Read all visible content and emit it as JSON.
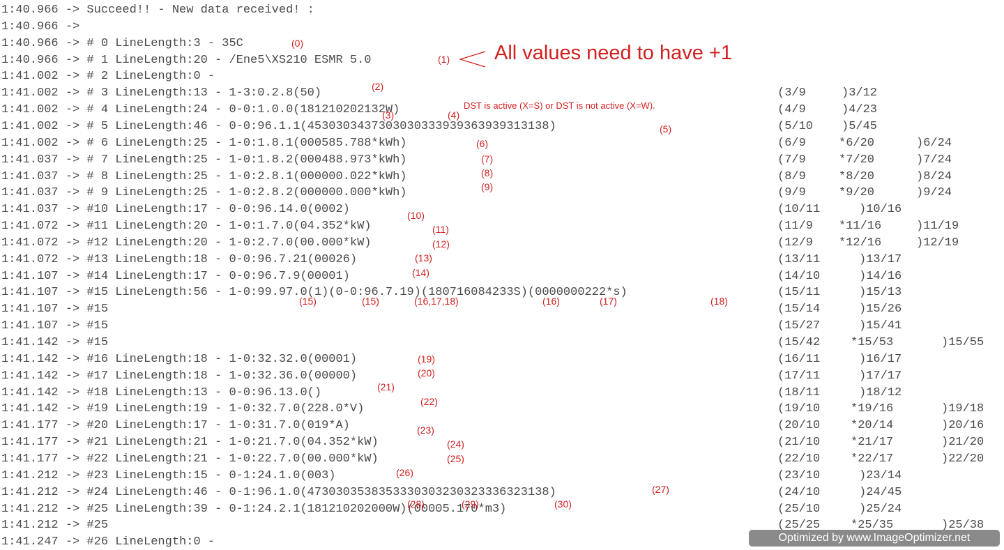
{
  "log": {
    "lines": [
      {
        "ts": "1:40.966 ->",
        "text": " Succeed!! - New data received! :"
      },
      {
        "ts": "1:40.966 ->",
        "text": ""
      },
      {
        "ts": "1:40.966 ->",
        "text": " # 0 LineLength:3 - 35C"
      },
      {
        "ts": "1:40.966 ->",
        "text": " # 1 LineLength:20 - /Ene5\\XS210 ESMR 5.0"
      },
      {
        "ts": "1:41.002 ->",
        "text": " # 2 LineLength:0 -"
      },
      {
        "ts": "1:41.002 ->",
        "text": " # 3 LineLength:13 - 1-3:0.2.8(50)"
      },
      {
        "ts": "1:41.002 ->",
        "text": " # 4 LineLength:24 - 0-0:1.0.0(181210202132W)"
      },
      {
        "ts": "1:41.002 ->",
        "text": " # 5 LineLength:46 - 0-0:96.1.1(4530303437303030333939363939313138)"
      },
      {
        "ts": "1:41.002 ->",
        "text": " # 6 LineLength:25 - 1-0:1.8.1(000585.788*kWh)"
      },
      {
        "ts": "1:41.037 ->",
        "text": " # 7 LineLength:25 - 1-0:1.8.2(000488.973*kWh)"
      },
      {
        "ts": "1:41.037 ->",
        "text": " # 8 LineLength:25 - 1-0:2.8.1(000000.022*kWh)"
      },
      {
        "ts": "1:41.037 ->",
        "text": " # 9 LineLength:25 - 1-0:2.8.2(000000.000*kWh)"
      },
      {
        "ts": "1:41.037 ->",
        "text": " #10 LineLength:17 - 0-0:96.14.0(0002)"
      },
      {
        "ts": "1:41.072 ->",
        "text": " #11 LineLength:20 - 1-0:1.7.0(04.352*kW)"
      },
      {
        "ts": "1:41.072 ->",
        "text": " #12 LineLength:20 - 1-0:2.7.0(00.000*kW)"
      },
      {
        "ts": "1:41.072 ->",
        "text": " #13 LineLength:18 - 0-0:96.7.21(00026)"
      },
      {
        "ts": "1:41.107 ->",
        "text": " #14 LineLength:17 - 0-0:96.7.9(00001)"
      },
      {
        "ts": "1:41.107 ->",
        "text": " #15 LineLength:56 - 1-0:99.97.0(1)(0-0:96.7.19)(180716084233S)(0000000222*s)"
      },
      {
        "ts": "1:41.107 ->",
        "text": " #15"
      },
      {
        "ts": "1:41.107 ->",
        "text": " #15"
      },
      {
        "ts": "1:41.142 ->",
        "text": " #15"
      },
      {
        "ts": "1:41.142 ->",
        "text": " #16 LineLength:18 - 1-0:32.32.0(00001)"
      },
      {
        "ts": "1:41.142 ->",
        "text": " #17 LineLength:18 - 1-0:32.36.0(00000)"
      },
      {
        "ts": "1:41.142 ->",
        "text": " #18 LineLength:13 - 0-0:96.13.0()"
      },
      {
        "ts": "1:41.142 ->",
        "text": " #19 LineLength:19 - 1-0:32.7.0(228.0*V)"
      },
      {
        "ts": "1:41.177 ->",
        "text": " #20 LineLength:17 - 1-0:31.7.0(019*A)"
      },
      {
        "ts": "1:41.177 ->",
        "text": " #21 LineLength:21 - 1-0:21.7.0(04.352*kW)"
      },
      {
        "ts": "1:41.177 ->",
        "text": " #22 LineLength:21 - 1-0:22.7.0(00.000*kW)"
      },
      {
        "ts": "1:41.212 ->",
        "text": " #23 LineLength:15 - 0-1:24.1.0(003)"
      },
      {
        "ts": "1:41.212 ->",
        "text": " #24 LineLength:46 - 0-1:96.1.0(4730303538353330303230323336323138)"
      },
      {
        "ts": "1:41.212 ->",
        "text": " #25 LineLength:39 - 0-1:24.2.1(181210202000W)(00005.170*m3)"
      },
      {
        "ts": "1:41.212 ->",
        "text": " #25"
      },
      {
        "ts": "1:41.247 ->",
        "text": " #26 LineLength:0 -"
      }
    ]
  },
  "right_columns": [
    {
      "row": 5,
      "c1": "(3/9",
      "c2": ")3/12",
      "c3": ""
    },
    {
      "row": 6,
      "c1": "(4/9",
      "c2": ")4/23",
      "c3": ""
    },
    {
      "row": 7,
      "c1": "(5/10",
      "c2": ")5/45",
      "c3": ""
    },
    {
      "row": 8,
      "c1": "(6/9",
      "c2": "*6/20",
      "c3": ")6/24"
    },
    {
      "row": 9,
      "c1": "(7/9",
      "c2": "*7/20",
      "c3": ")7/24"
    },
    {
      "row": 10,
      "c1": "(8/9",
      "c2": "*8/20",
      "c3": ")8/24"
    },
    {
      "row": 11,
      "c1": "(9/9",
      "c2": "*9/20",
      "c3": ")9/24"
    },
    {
      "row": 12,
      "c1": "(10/11",
      "c2": ")10/16",
      "c3": ""
    },
    {
      "row": 13,
      "c1": "(11/9",
      "c2": "*11/16",
      "c3": ")11/19"
    },
    {
      "row": 14,
      "c1": "(12/9",
      "c2": "*12/16",
      "c3": ")12/19"
    },
    {
      "row": 15,
      "c1": "(13/11",
      "c2": ")13/17",
      "c3": ""
    },
    {
      "row": 16,
      "c1": "(14/10",
      "c2": ")14/16",
      "c3": ""
    },
    {
      "row": 17,
      "c1": "(15/11",
      "c2": ")15/13",
      "c3": ""
    },
    {
      "row": 18,
      "c1": "(15/14",
      "c2": ")15/26",
      "c3": ""
    },
    {
      "row": 19,
      "c1": "(15/27",
      "c2": ")15/41",
      "c3": ""
    },
    {
      "row": 20,
      "c1": "(15/42",
      "c2": "*15/53",
      "c3": ")15/55"
    },
    {
      "row": 21,
      "c1": "(16/11",
      "c2": ")16/17",
      "c3": ""
    },
    {
      "row": 22,
      "c1": "(17/11",
      "c2": ")17/17",
      "c3": ""
    },
    {
      "row": 23,
      "c1": "(18/11",
      "c2": ")18/12",
      "c3": ""
    },
    {
      "row": 24,
      "c1": "(19/10",
      "c2": "*19/16",
      "c3": ")19/18"
    },
    {
      "row": 25,
      "c1": "(20/10",
      "c2": "*20/14",
      "c3": ")20/16"
    },
    {
      "row": 26,
      "c1": "(21/10",
      "c2": "*21/17",
      "c3": ")21/20"
    },
    {
      "row": 27,
      "c1": "(22/10",
      "c2": "*22/17",
      "c3": ")22/20"
    },
    {
      "row": 28,
      "c1": "(23/10",
      "c2": ")23/14",
      "c3": ""
    },
    {
      "row": 29,
      "c1": "(24/10",
      "c2": ")24/45",
      "c3": ""
    },
    {
      "row": 30,
      "c1": "(25/10",
      "c2": ")25/24",
      "c3": ""
    },
    {
      "row": 31,
      "c1": "(25/25",
      "c2": "*25/35",
      "c3": ")25/38"
    }
  ],
  "annotations": {
    "a0": "(0)",
    "a1": "(1)",
    "a2": "(2)",
    "a3": "(3)",
    "a4": "(4)",
    "a5": "(5)",
    "a6": "(6)",
    "a7": "(7)",
    "a8": "(8)",
    "a9": "(9)",
    "a10": "(10)",
    "a11": "(11)",
    "a12": "(12)",
    "a13": "(13)",
    "a14": "(14)",
    "a15a": "(15)",
    "a15b": "(15)",
    "a16_18": "(16,17,18)",
    "a16": "(16)",
    "a17": "(17)",
    "a18": "(18)",
    "a19": "(19)",
    "a20": "(20)",
    "a21": "(21)",
    "a22": "(22)",
    "a23": "(23)",
    "a24": "(24)",
    "a25": "(25)",
    "a26": "(26)",
    "a27": "(27)",
    "a28": "(28)",
    "a29": "(29)",
    "a30": "(30)"
  },
  "notes": {
    "values_plus_one": "All values need to have +1",
    "dst": "DST is active (X=S) or DST is not active (X=W)."
  },
  "watermark": "Optimized by www.ImageOptimizer.net",
  "colors": {
    "annotation": "#d21f1f",
    "log_text": "#4a4a4a",
    "watermark_bg": "#8a8a8a"
  }
}
